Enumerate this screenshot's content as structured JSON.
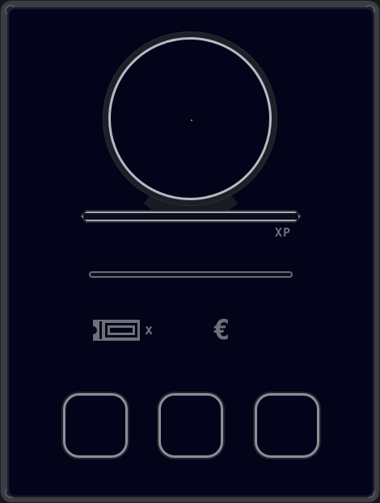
{
  "xp": {
    "label": "XP"
  },
  "currency": {
    "ticket_multiplier_label": "x",
    "euro_symbol": "€",
    "ticket_icon": "ticket-icon",
    "euro_icon": "euro-icon"
  },
  "inventory": {
    "slots": [
      "",
      "",
      ""
    ]
  },
  "colors": {
    "panel_background": "#03041a",
    "frame": "#3c3c44",
    "outline": "#b9b9c2",
    "muted_text": "#6c6c74",
    "screw": "#2b3170"
  }
}
